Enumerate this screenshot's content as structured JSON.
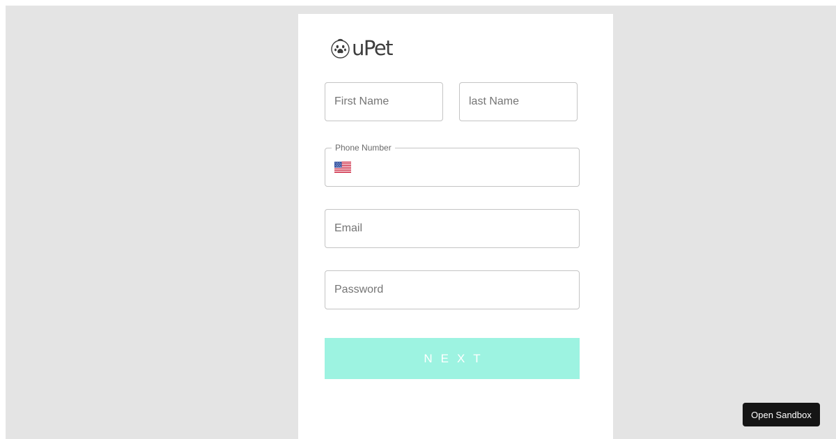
{
  "brand": {
    "logo_text": "uPet",
    "logo_icon": "paw-icon"
  },
  "form": {
    "first_name": {
      "placeholder": "First Name",
      "value": ""
    },
    "last_name": {
      "placeholder": "last Name",
      "value": ""
    },
    "phone": {
      "label": "Phone Number",
      "country_flag": "us-flag-icon",
      "value": ""
    },
    "email": {
      "placeholder": "Email",
      "value": ""
    },
    "password": {
      "placeholder": "Password",
      "value": ""
    },
    "next_label": "NEXT"
  },
  "sandbox": {
    "label": "Open Sandbox"
  },
  "colors": {
    "page_background": "#e4e4e4",
    "card_background": "#ffffff",
    "next_button": "#9df3e1",
    "sandbox_button": "#151515"
  }
}
